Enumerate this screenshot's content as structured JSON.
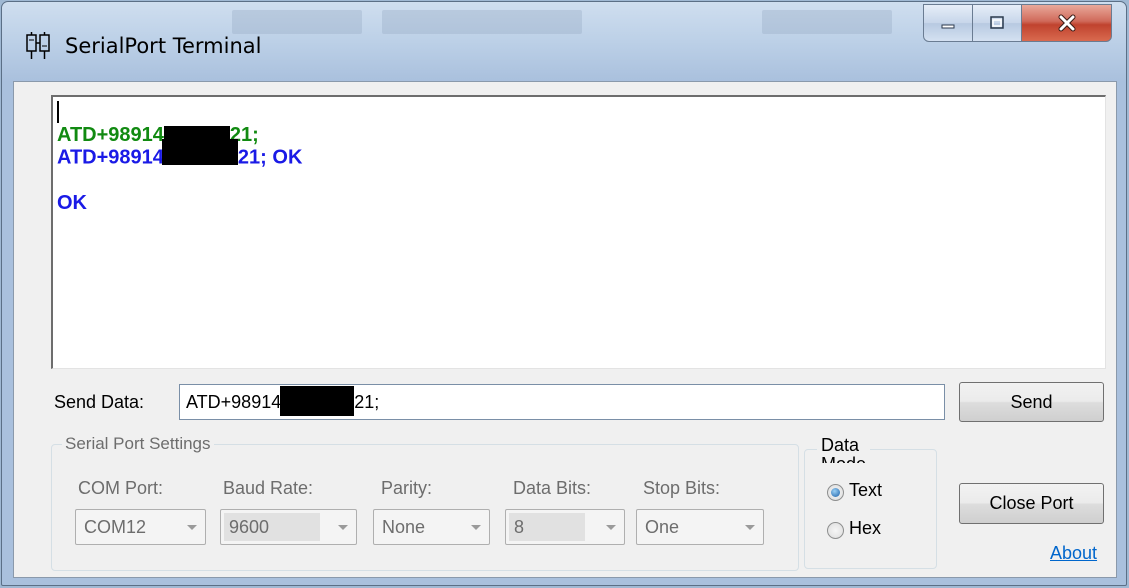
{
  "window": {
    "title": "SerialPort Terminal"
  },
  "terminal": {
    "lines": [
      {
        "before": "ATD+98914",
        "after": "21;",
        "color": "#118a11"
      },
      {
        "before": "ATD+98914",
        "after": "21; OK",
        "color": "#1a1ae6"
      },
      {
        "text": "OK",
        "color": "#1a1ae6"
      }
    ]
  },
  "send": {
    "label": "Send Data:",
    "value_before": "ATD+98914",
    "value_after": "21;",
    "button": "Send"
  },
  "settings": {
    "legend": "Serial Port Settings",
    "com_port": {
      "label": "COM Port:",
      "value": "COM12"
    },
    "baud_rate": {
      "label": "Baud Rate:",
      "value": "9600"
    },
    "parity": {
      "label": "Parity:",
      "value": "None"
    },
    "data_bits": {
      "label": "Data Bits:",
      "value": "8"
    },
    "stop_bits": {
      "label": "Stop Bits:",
      "value": "One"
    }
  },
  "data_mode": {
    "legend_line1": "Data",
    "legend_line2": "Mode",
    "options": [
      {
        "label": "Text",
        "selected": true
      },
      {
        "label": "Hex",
        "selected": false
      }
    ]
  },
  "buttons": {
    "close_port": "Close Port",
    "about": "About"
  }
}
